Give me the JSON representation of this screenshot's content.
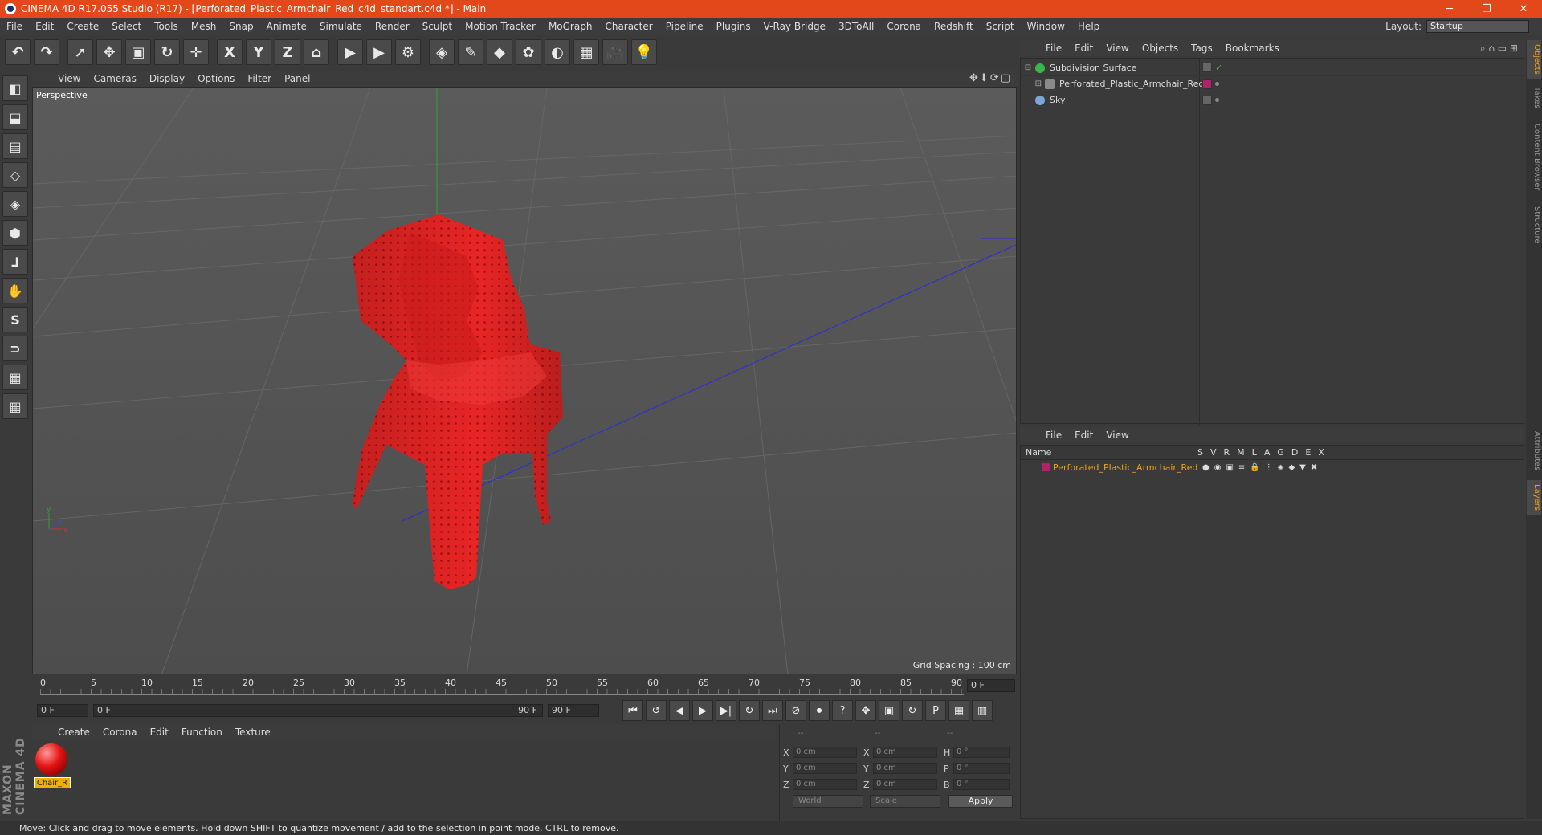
{
  "window": {
    "title": "CINEMA 4D R17.055 Studio (R17) - [Perforated_Plastic_Armchair_Red_c4d_standart.c4d *] - Main",
    "controls": [
      "─",
      "❐",
      "✕"
    ]
  },
  "menu": [
    "File",
    "Edit",
    "Create",
    "Select",
    "Tools",
    "Mesh",
    "Snap",
    "Animate",
    "Simulate",
    "Render",
    "Sculpt",
    "Motion Tracker",
    "MoGraph",
    "Character",
    "Pipeline",
    "Plugins",
    "V-Ray Bridge",
    "3DToAll",
    "Corona",
    "Redshift",
    "Script",
    "Window",
    "Help"
  ],
  "layout": {
    "label": "Layout:",
    "value": "Startup"
  },
  "toolbar": {
    "icons": [
      "undo-icon",
      "redo-icon",
      "select-icon",
      "move-icon",
      "scale-icon",
      "rotate-icon",
      "transform-icon",
      "x-axis-icon",
      "y-axis-icon",
      "z-axis-icon",
      "world-coord-icon",
      "render-view-icon",
      "render-picture-queue-icon",
      "edit-render-settings-icon",
      "cube-icon",
      "pen-icon",
      "subdivision-icon",
      "cloner-icon",
      "deformer-icon",
      "floor-icon",
      "camera-icon",
      "light-icon"
    ],
    "glyphs": [
      "↶",
      "↷",
      "➚",
      "✥",
      "▣",
      "↻",
      "✛",
      "X",
      "Y",
      "Z",
      "⌂",
      "▶",
      "▶",
      "⚙",
      "◈",
      "✎",
      "◆",
      "✿",
      "◐",
      "▦",
      "🎥",
      "💡"
    ]
  },
  "lefttools": {
    "icons": [
      "model-mode-icon",
      "texture-mode-icon",
      "workplane-icon",
      "points-mode-icon",
      "edges-mode-icon",
      "polygons-mode-icon",
      "axis-mode-icon",
      "tweak-icon",
      "snap-icon",
      "magnet-icon",
      "lock-grid-icon",
      "soft-select-icon"
    ],
    "glyphs": [
      "◧",
      "⬓",
      "▤",
      "◇",
      "◈",
      "⬢",
      "⅃",
      "✋",
      "S",
      "⊃",
      "▦",
      "▦"
    ]
  },
  "maxon_logo": "MAXON CINEMA 4D",
  "viewport": {
    "menu": [
      "View",
      "Cameras",
      "Display",
      "Options",
      "Filter",
      "Panel"
    ],
    "nav_icons": "✥⬇⟳▢",
    "label": "Perspective",
    "grid_spacing": "Grid Spacing : 100 cm",
    "axis": {
      "x": "x",
      "y": "y",
      "z": "z"
    }
  },
  "timeline": {
    "ticks": [
      "0",
      "5",
      "10",
      "15",
      "20",
      "25",
      "30",
      "35",
      "40",
      "45",
      "50",
      "55",
      "60",
      "65",
      "70",
      "75",
      "80",
      "85",
      "90"
    ],
    "current_frame": "0 F",
    "start": "0 F",
    "range_start": "0 F",
    "range_end": "90 F",
    "end": "90 F"
  },
  "transport": {
    "icons": [
      "go-start-icon",
      "prev-key-icon",
      "play-back-icon",
      "play-icon",
      "next-frame-icon",
      "next-key-icon",
      "go-end-icon",
      "record-icon",
      "autokey-icon",
      "help-keys-icon",
      "move-key-icon",
      "scale-key-icon",
      "rotate-key-icon",
      "param-key-icon",
      "pla-icon",
      "timeline-icon"
    ],
    "glyphs": [
      "⏮",
      "↺",
      "◀",
      "▶",
      "▶|",
      "↻",
      "⏭",
      "⊘",
      "⏺",
      "?",
      "✥",
      "▣",
      "↻",
      "P",
      "▦",
      "▥"
    ]
  },
  "material_manager": {
    "menu": [
      "Create",
      "Corona",
      "Edit",
      "Function",
      "Texture"
    ],
    "materials": [
      {
        "label": "Chair_R"
      }
    ]
  },
  "coordinates": {
    "headers": [
      "--",
      "--",
      "--"
    ],
    "rows": [
      {
        "a": "X",
        "av": "0 cm",
        "b": "X",
        "bv": "0 cm",
        "c": "H",
        "cv": "0 °"
      },
      {
        "a": "Y",
        "av": "0 cm",
        "b": "Y",
        "bv": "0 cm",
        "c": "P",
        "cv": "0 °"
      },
      {
        "a": "Z",
        "av": "0 cm",
        "b": "Z",
        "bv": "0 cm",
        "c": "B",
        "cv": "0 °"
      }
    ],
    "world": "World",
    "scale": "Scale",
    "apply": "Apply"
  },
  "status": "Move: Click and drag to move elements. Hold down SHIFT to quantize movement / add to the selection in point mode, CTRL to remove.",
  "objects_panel": {
    "menu": [
      "File",
      "Edit",
      "View",
      "Objects",
      "Tags",
      "Bookmarks"
    ],
    "items": [
      {
        "name": "Subdivision Surface",
        "color": "#39b54a"
      },
      {
        "name": "Perforated_Plastic_Armchair_Red",
        "color": "#8a8a8a"
      },
      {
        "name": "Sky",
        "color": "#7aa7d6"
      }
    ]
  },
  "layers_panel": {
    "menu": [
      "File",
      "Edit",
      "View"
    ],
    "header_name": "Name",
    "columns": [
      "S",
      "V",
      "R",
      "M",
      "L",
      "A",
      "G",
      "D",
      "E",
      "X"
    ],
    "layer": {
      "name": "Perforated_Plastic_Armchair_Red",
      "color": "#b1226b"
    }
  },
  "vertical_tabs": [
    "Objects",
    "Takes",
    "Content Browser",
    "Structure",
    "Attributes",
    "Layers"
  ],
  "colors": {
    "title_bar": "#e3481b",
    "chair": "#e82525",
    "highlight": "#f0a11a"
  }
}
